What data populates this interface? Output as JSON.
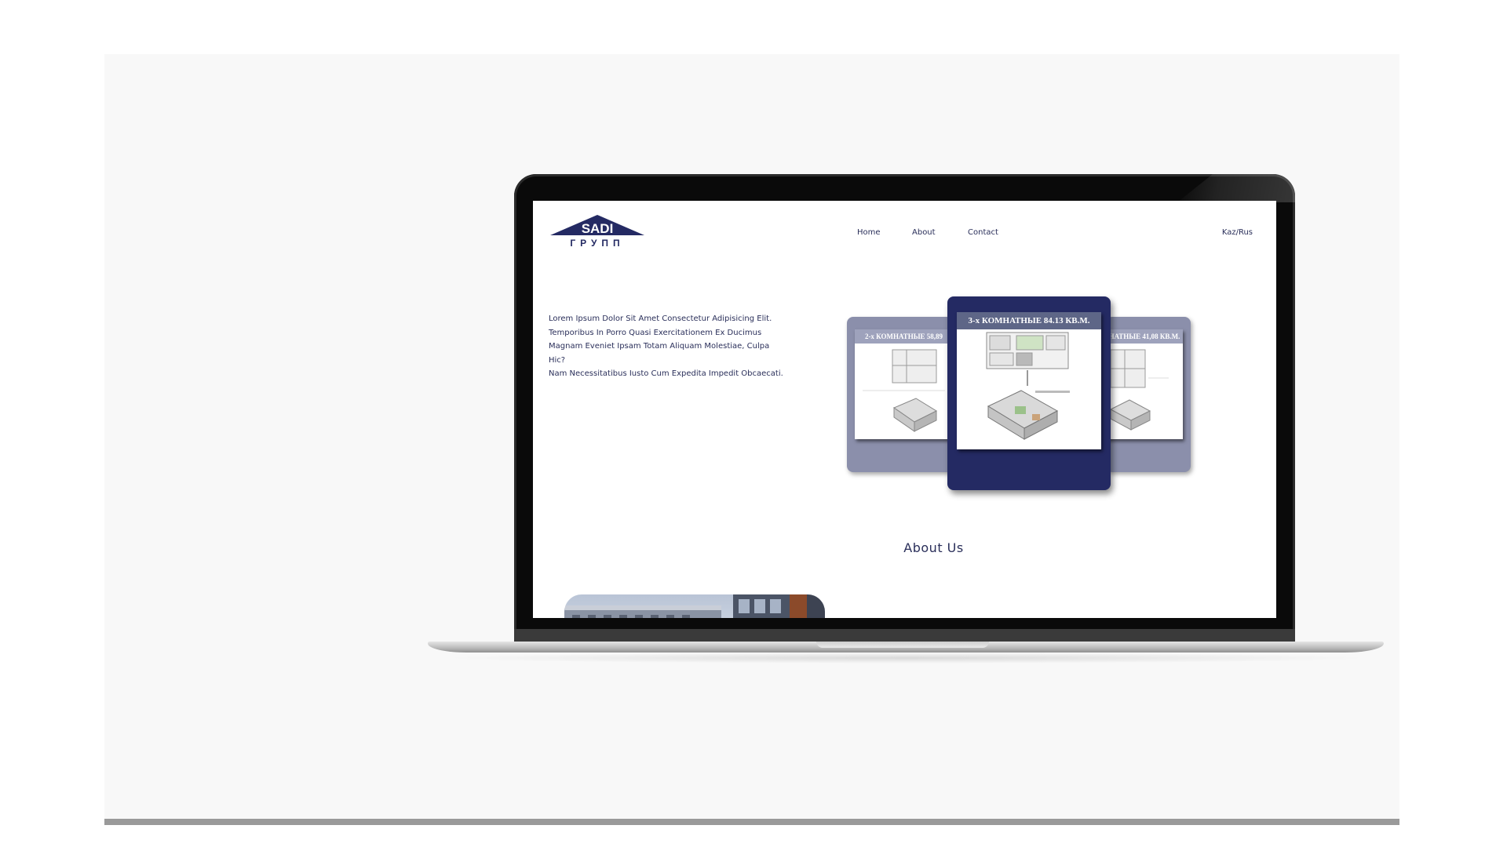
{
  "site": {
    "logo": {
      "top_text": "SADI",
      "bottom_text": "ГРУПП"
    },
    "nav": [
      {
        "label": "Home"
      },
      {
        "label": "About"
      },
      {
        "label": "Contact"
      }
    ],
    "language_switch": "Kaz/Rus",
    "intro_lines": [
      "Lorem Ipsum Dolor Sit Amet Consectetur Adipisicing Elit.",
      "Temporibus In Porro Quasi Exercitationem Ex Ducimus",
      "Magnam Eveniet Ipsam Totam Aliquam Molestiae, Culpa Hic?",
      "Nam Necessitatibus Iusto Cum Expedita Impedit Obcaecati."
    ],
    "carousel": {
      "left_card_title": "2-х КОМНАТНЫЕ 58,89",
      "center_card_title": "3-х КОМНАТНЫЕ 84.13 КВ.М.",
      "right_card_title": "НАТНЫЕ 41,08 КВ.М."
    },
    "about_heading": "About Us"
  },
  "colors": {
    "brand_navy": "#242a63",
    "card_side": "#8b8fab",
    "text": "#2a2f5a",
    "stage_bg": "#f8f8f8"
  }
}
